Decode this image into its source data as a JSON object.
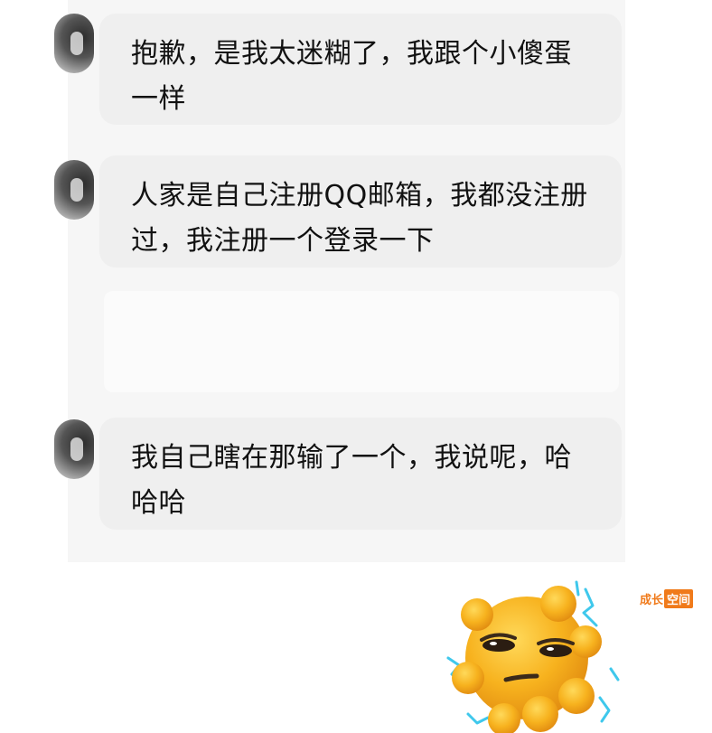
{
  "messages": [
    {
      "text": "抱歉，是我太迷糊了，我跟个小傻蛋一样"
    },
    {
      "text": "人家是自己注册QQ邮箱，我都没注册过，我注册一个登录一下"
    },
    {
      "text": ""
    },
    {
      "text": "我自己瞎在那输了一个，我说呢，哈哈哈"
    }
  ],
  "watermark": {
    "plain": "成长",
    "boxed": "空间"
  },
  "sticker": {
    "icon": "sweating-sun-emoji-icon"
  },
  "colors": {
    "bubble": "#efefef",
    "accent": "#f07a1a",
    "sun": "#f7b21e"
  }
}
